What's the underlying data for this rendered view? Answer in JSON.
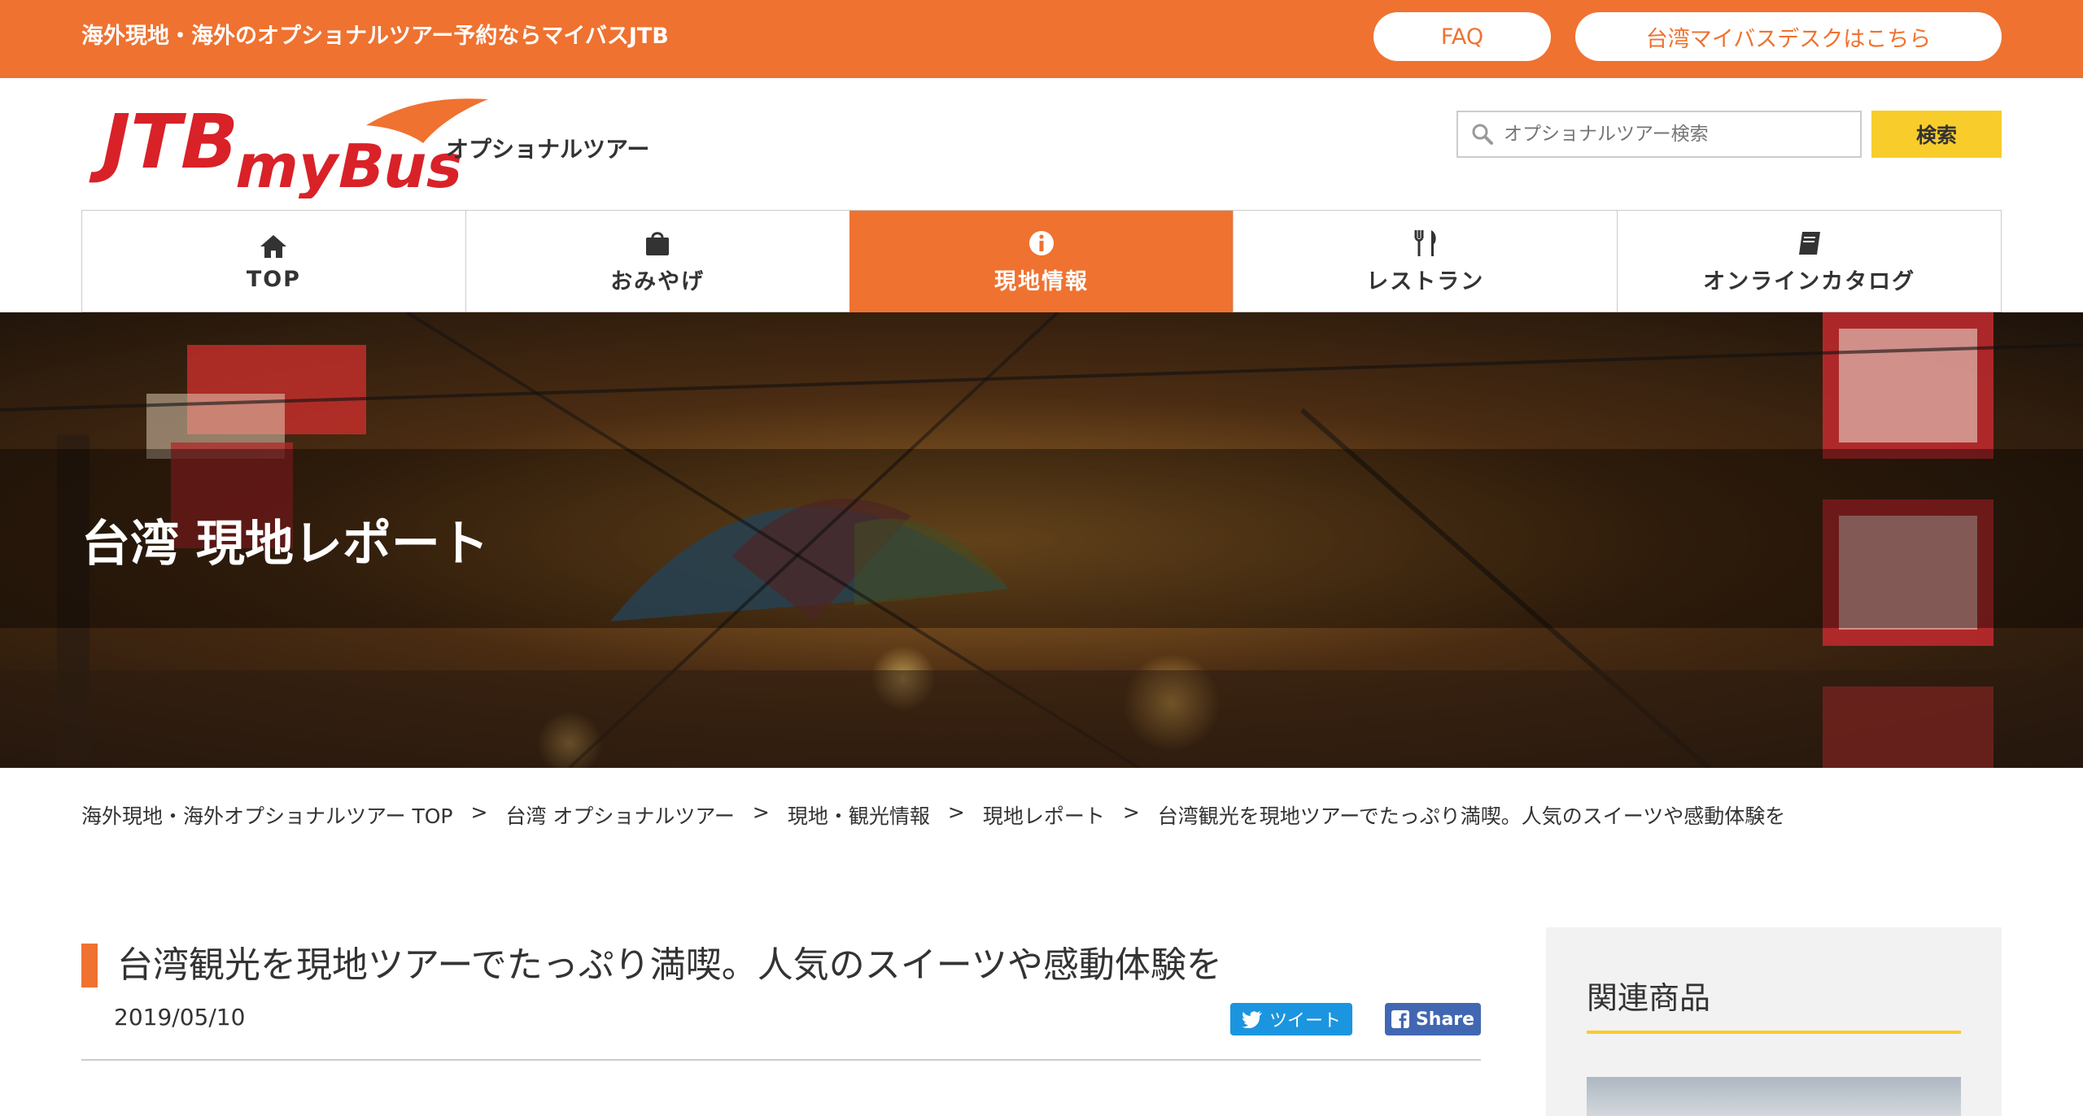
{
  "topbar": {
    "tagline": "海外現地・海外のオプショナルツアー予約ならマイバスJTB",
    "faq_label": "FAQ",
    "desk_label": "台湾マイバスデスクはこちら"
  },
  "header": {
    "logo_text": "JTB myBus",
    "logo_subtitle": "オプショナルツアー",
    "search_placeholder": "オプショナルツアー検索",
    "search_button": "検索"
  },
  "nav": {
    "items": [
      {
        "label": "TOP",
        "icon": "home-icon"
      },
      {
        "label": "おみやげ",
        "icon": "shopping-bag-icon"
      },
      {
        "label": "現地情報",
        "icon": "info-icon"
      },
      {
        "label": "レストラン",
        "icon": "fork-knife-icon"
      },
      {
        "label": "オンラインカタログ",
        "icon": "book-icon"
      }
    ],
    "active_index": 2
  },
  "hero": {
    "title": "台湾 現地レポート"
  },
  "breadcrumb": {
    "items": [
      "海外現地・海外オプショナルツアー TOP",
      "台湾 オプショナルツアー",
      "現地・観光情報",
      "現地レポート",
      "台湾観光を現地ツアーでたっぷり満喫。人気のスイーツや感動体験を"
    ],
    "separator": ">"
  },
  "article": {
    "title": "台湾観光を現地ツアーでたっぷり満喫。人気のスイーツや感動体験を",
    "date": "2019/05/10",
    "tweet_label": "ツイート",
    "share_label": "Share"
  },
  "sidebar": {
    "heading": "関連商品"
  },
  "colors": {
    "brand_orange": "#ef7230",
    "accent_yellow": "#f8cd2b",
    "twitter_blue": "#1b95e0",
    "facebook_blue": "#4267b2"
  }
}
